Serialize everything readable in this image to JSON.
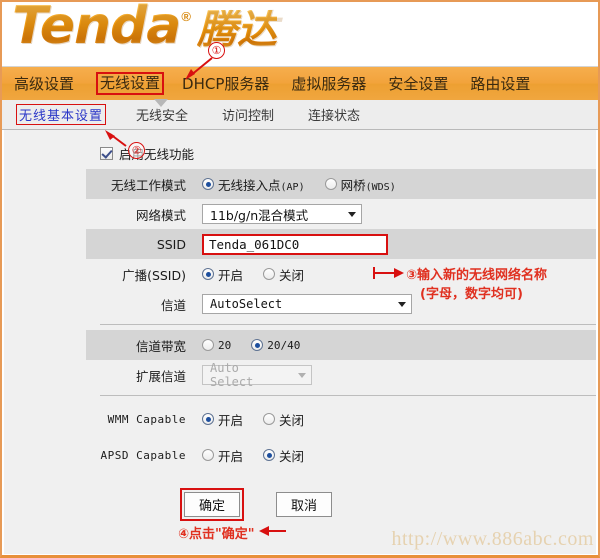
{
  "brand": {
    "logo_latin": "Tenda",
    "logo_registered": "®",
    "logo_cn": "腾达"
  },
  "main_nav": {
    "items": [
      {
        "label": "高级设置",
        "highlighted": false
      },
      {
        "label": "无线设置",
        "highlighted": true
      },
      {
        "label": "DHCP服务器",
        "highlighted": false
      },
      {
        "label": "虚拟服务器",
        "highlighted": false
      },
      {
        "label": "安全设置",
        "highlighted": false
      },
      {
        "label": "路由设置",
        "highlighted": false
      }
    ]
  },
  "sub_nav": {
    "items": [
      {
        "label": "无线基本设置",
        "active": true
      },
      {
        "label": "无线安全",
        "active": false
      },
      {
        "label": "访问控制",
        "active": false
      },
      {
        "label": "连接状态",
        "active": false
      }
    ]
  },
  "form": {
    "enable_wireless": {
      "label": "启用无线功能",
      "checked": true
    },
    "work_mode": {
      "label": "无线工作模式",
      "options": [
        {
          "label": "无线接入点",
          "suffix": "(AP)",
          "selected": true
        },
        {
          "label": "网桥",
          "suffix": "(WDS)",
          "selected": false
        }
      ]
    },
    "network_mode": {
      "label": "网络模式",
      "value": "11b/g/n混合模式"
    },
    "ssid": {
      "label": "SSID",
      "value": "Tenda_061DC0"
    },
    "broadcast_ssid": {
      "label": "广播(SSID)",
      "options": [
        {
          "label": "开启",
          "selected": true
        },
        {
          "label": "关闭",
          "selected": false
        }
      ]
    },
    "channel": {
      "label": "信道",
      "value": "AutoSelect"
    },
    "channel_bandwidth": {
      "label": "信道带宽",
      "options": [
        {
          "label": "20",
          "selected": false
        },
        {
          "label": "20/40",
          "selected": true
        }
      ]
    },
    "extension_channel": {
      "label": "扩展信道",
      "value": "Auto Select",
      "disabled": true
    },
    "wmm_capable": {
      "label": "WMM Capable",
      "options": [
        {
          "label": "开启",
          "selected": true
        },
        {
          "label": "关闭",
          "selected": false
        }
      ]
    },
    "apsd_capable": {
      "label": "APSD Capable",
      "options": [
        {
          "label": "开启",
          "selected": false
        },
        {
          "label": "关闭",
          "selected": true
        }
      ]
    },
    "buttons": {
      "ok": "确定",
      "cancel": "取消"
    }
  },
  "annotations": {
    "step1": {
      "num": "①"
    },
    "step2": {
      "num": "②"
    },
    "step3": {
      "num": "③",
      "line1": "③输入新的无线网络名称",
      "line2": "(字母，数字均可)"
    },
    "step4": {
      "text": "④点击\"确定\""
    }
  },
  "watermark": "http://www.886abc.com",
  "colors": {
    "brand_orange": "#f0a63f",
    "annotation_red": "#d81010",
    "active_tab_blue": "#2b37c8",
    "row_shade": "#d5d5d5",
    "content_bg": "#f0f0f0"
  }
}
